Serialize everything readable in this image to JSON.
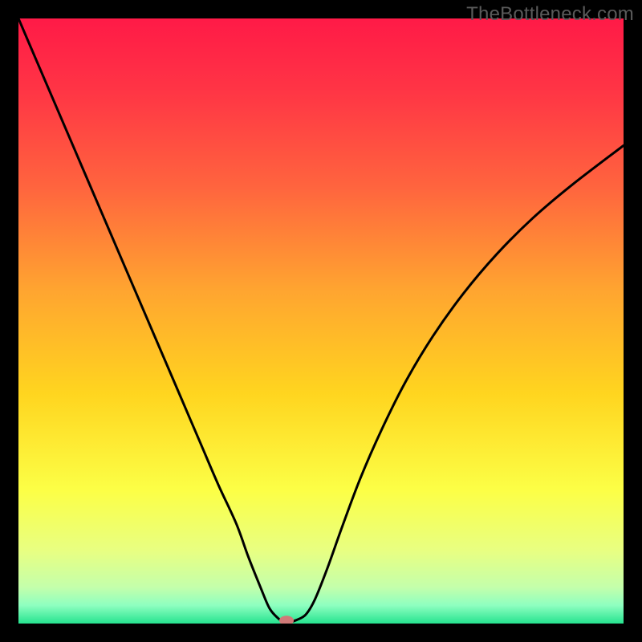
{
  "watermark": "TheBottleneck.com",
  "chart_data": {
    "type": "line",
    "title": "",
    "xlabel": "",
    "ylabel": "",
    "xlim": [
      0,
      100
    ],
    "ylim": [
      0,
      100
    ],
    "background": {
      "gradient_stops": [
        {
          "offset": 0.0,
          "color": "#ff1a47"
        },
        {
          "offset": 0.12,
          "color": "#ff3545"
        },
        {
          "offset": 0.28,
          "color": "#ff653e"
        },
        {
          "offset": 0.45,
          "color": "#ffa530"
        },
        {
          "offset": 0.62,
          "color": "#ffd51f"
        },
        {
          "offset": 0.78,
          "color": "#fcff46"
        },
        {
          "offset": 0.88,
          "color": "#e8ff82"
        },
        {
          "offset": 0.94,
          "color": "#c4ffab"
        },
        {
          "offset": 0.97,
          "color": "#8effc0"
        },
        {
          "offset": 1.0,
          "color": "#26e38f"
        }
      ]
    },
    "series": [
      {
        "name": "bottleneck-curve",
        "color": "#000000",
        "x": [
          0.0,
          3.0,
          6.0,
          9.0,
          12.0,
          15.0,
          18.0,
          21.0,
          24.0,
          27.0,
          30.0,
          33.0,
          36.0,
          38.0,
          40.0,
          41.5,
          43.0,
          44.0,
          45.0,
          46.0,
          47.5,
          49.0,
          51.0,
          53.5,
          56.5,
          60.0,
          64.0,
          68.5,
          73.5,
          79.0,
          85.0,
          91.5,
          100.0
        ],
        "y": [
          100.0,
          93.0,
          86.0,
          79.0,
          72.0,
          65.0,
          58.0,
          51.0,
          44.0,
          37.0,
          30.0,
          23.0,
          16.5,
          11.0,
          6.0,
          2.5,
          0.8,
          0.3,
          0.3,
          0.6,
          1.5,
          4.0,
          9.0,
          16.0,
          24.0,
          32.0,
          40.0,
          47.5,
          54.5,
          61.0,
          67.0,
          72.5,
          79.0
        ]
      }
    ],
    "marker": {
      "name": "optimal-point",
      "x": 44.3,
      "y": 0.5,
      "color": "#d07a78",
      "rx": 9,
      "ry": 6
    }
  }
}
